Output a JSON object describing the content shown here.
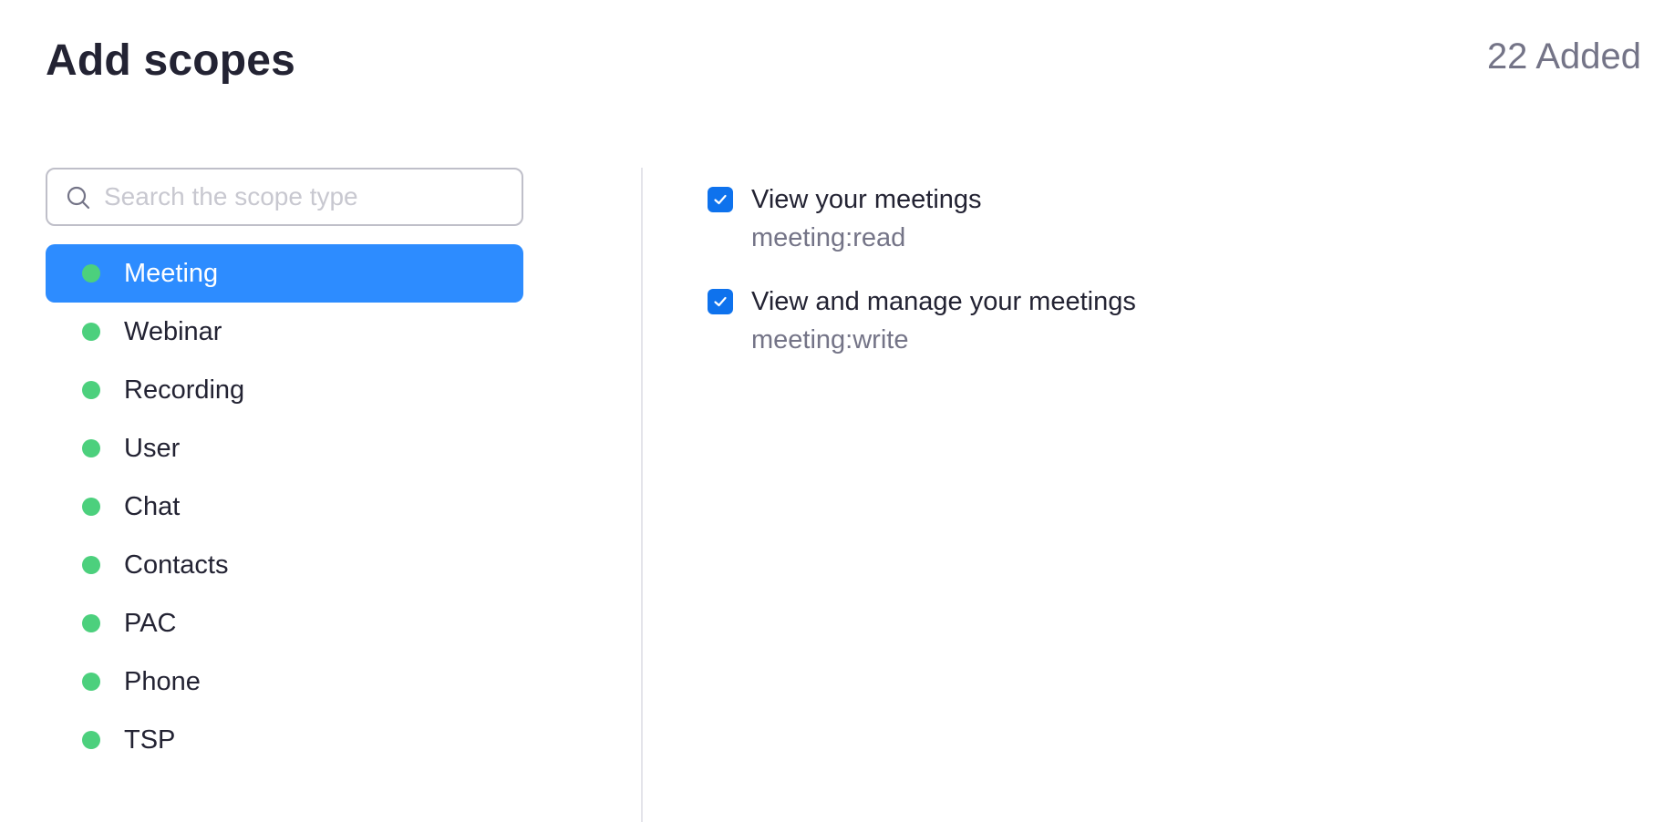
{
  "header": {
    "title": "Add scopes",
    "added_count": "22 Added"
  },
  "search": {
    "placeholder": "Search the scope type",
    "value": "",
    "icon": "search-icon"
  },
  "scope_types": [
    {
      "label": "Meeting",
      "selected": true
    },
    {
      "label": "Webinar",
      "selected": false
    },
    {
      "label": "Recording",
      "selected": false
    },
    {
      "label": "User",
      "selected": false
    },
    {
      "label": "Chat",
      "selected": false
    },
    {
      "label": "Contacts",
      "selected": false
    },
    {
      "label": "PAC",
      "selected": false
    },
    {
      "label": "Phone",
      "selected": false
    },
    {
      "label": "TSP",
      "selected": false
    }
  ],
  "permissions": [
    {
      "title": "View your meetings",
      "code": "meeting:read",
      "checked": true
    },
    {
      "title": "View and manage your meetings",
      "code": "meeting:write",
      "checked": true
    }
  ],
  "colors": {
    "accent": "#2d8cff",
    "checkbox": "#0e72ed",
    "status_dot": "#4cd07d",
    "muted_text": "#747487",
    "primary_text": "#232333"
  }
}
